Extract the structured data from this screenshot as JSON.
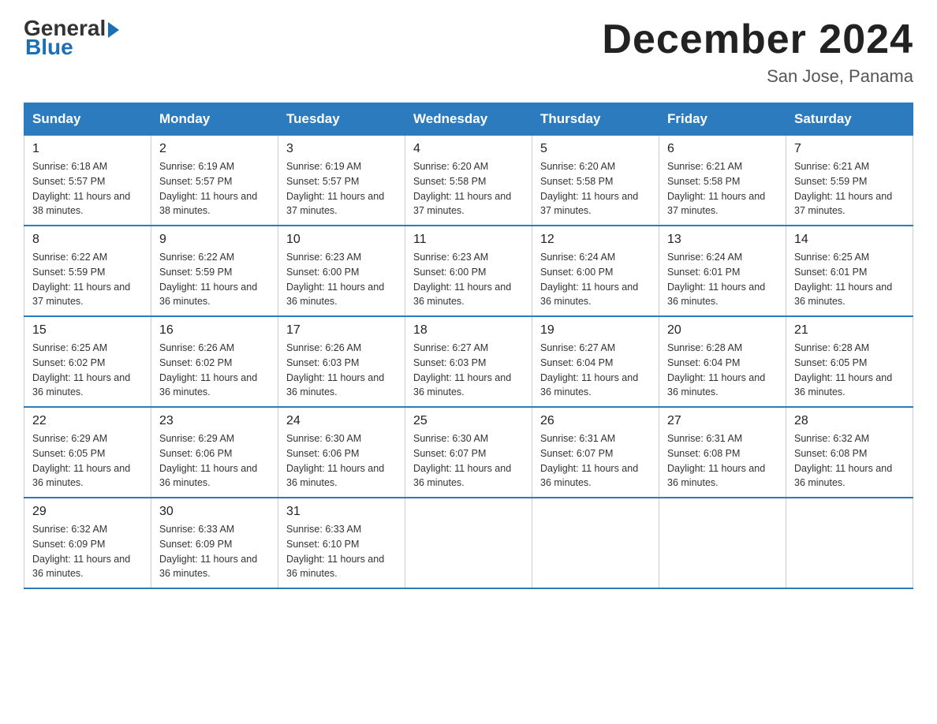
{
  "logo": {
    "general": "General",
    "arrow": "▶",
    "blue": "Blue"
  },
  "title": "December 2024",
  "subtitle": "San Jose, Panama",
  "headers": [
    "Sunday",
    "Monday",
    "Tuesday",
    "Wednesday",
    "Thursday",
    "Friday",
    "Saturday"
  ],
  "weeks": [
    [
      {
        "day": "1",
        "sunrise": "6:18 AM",
        "sunset": "5:57 PM",
        "daylight": "11 hours and 38 minutes."
      },
      {
        "day": "2",
        "sunrise": "6:19 AM",
        "sunset": "5:57 PM",
        "daylight": "11 hours and 38 minutes."
      },
      {
        "day": "3",
        "sunrise": "6:19 AM",
        "sunset": "5:57 PM",
        "daylight": "11 hours and 37 minutes."
      },
      {
        "day": "4",
        "sunrise": "6:20 AM",
        "sunset": "5:58 PM",
        "daylight": "11 hours and 37 minutes."
      },
      {
        "day": "5",
        "sunrise": "6:20 AM",
        "sunset": "5:58 PM",
        "daylight": "11 hours and 37 minutes."
      },
      {
        "day": "6",
        "sunrise": "6:21 AM",
        "sunset": "5:58 PM",
        "daylight": "11 hours and 37 minutes."
      },
      {
        "day": "7",
        "sunrise": "6:21 AM",
        "sunset": "5:59 PM",
        "daylight": "11 hours and 37 minutes."
      }
    ],
    [
      {
        "day": "8",
        "sunrise": "6:22 AM",
        "sunset": "5:59 PM",
        "daylight": "11 hours and 37 minutes."
      },
      {
        "day": "9",
        "sunrise": "6:22 AM",
        "sunset": "5:59 PM",
        "daylight": "11 hours and 36 minutes."
      },
      {
        "day": "10",
        "sunrise": "6:23 AM",
        "sunset": "6:00 PM",
        "daylight": "11 hours and 36 minutes."
      },
      {
        "day": "11",
        "sunrise": "6:23 AM",
        "sunset": "6:00 PM",
        "daylight": "11 hours and 36 minutes."
      },
      {
        "day": "12",
        "sunrise": "6:24 AM",
        "sunset": "6:00 PM",
        "daylight": "11 hours and 36 minutes."
      },
      {
        "day": "13",
        "sunrise": "6:24 AM",
        "sunset": "6:01 PM",
        "daylight": "11 hours and 36 minutes."
      },
      {
        "day": "14",
        "sunrise": "6:25 AM",
        "sunset": "6:01 PM",
        "daylight": "11 hours and 36 minutes."
      }
    ],
    [
      {
        "day": "15",
        "sunrise": "6:25 AM",
        "sunset": "6:02 PM",
        "daylight": "11 hours and 36 minutes."
      },
      {
        "day": "16",
        "sunrise": "6:26 AM",
        "sunset": "6:02 PM",
        "daylight": "11 hours and 36 minutes."
      },
      {
        "day": "17",
        "sunrise": "6:26 AM",
        "sunset": "6:03 PM",
        "daylight": "11 hours and 36 minutes."
      },
      {
        "day": "18",
        "sunrise": "6:27 AM",
        "sunset": "6:03 PM",
        "daylight": "11 hours and 36 minutes."
      },
      {
        "day": "19",
        "sunrise": "6:27 AM",
        "sunset": "6:04 PM",
        "daylight": "11 hours and 36 minutes."
      },
      {
        "day": "20",
        "sunrise": "6:28 AM",
        "sunset": "6:04 PM",
        "daylight": "11 hours and 36 minutes."
      },
      {
        "day": "21",
        "sunrise": "6:28 AM",
        "sunset": "6:05 PM",
        "daylight": "11 hours and 36 minutes."
      }
    ],
    [
      {
        "day": "22",
        "sunrise": "6:29 AM",
        "sunset": "6:05 PM",
        "daylight": "11 hours and 36 minutes."
      },
      {
        "day": "23",
        "sunrise": "6:29 AM",
        "sunset": "6:06 PM",
        "daylight": "11 hours and 36 minutes."
      },
      {
        "day": "24",
        "sunrise": "6:30 AM",
        "sunset": "6:06 PM",
        "daylight": "11 hours and 36 minutes."
      },
      {
        "day": "25",
        "sunrise": "6:30 AM",
        "sunset": "6:07 PM",
        "daylight": "11 hours and 36 minutes."
      },
      {
        "day": "26",
        "sunrise": "6:31 AM",
        "sunset": "6:07 PM",
        "daylight": "11 hours and 36 minutes."
      },
      {
        "day": "27",
        "sunrise": "6:31 AM",
        "sunset": "6:08 PM",
        "daylight": "11 hours and 36 minutes."
      },
      {
        "day": "28",
        "sunrise": "6:32 AM",
        "sunset": "6:08 PM",
        "daylight": "11 hours and 36 minutes."
      }
    ],
    [
      {
        "day": "29",
        "sunrise": "6:32 AM",
        "sunset": "6:09 PM",
        "daylight": "11 hours and 36 minutes."
      },
      {
        "day": "30",
        "sunrise": "6:33 AM",
        "sunset": "6:09 PM",
        "daylight": "11 hours and 36 minutes."
      },
      {
        "day": "31",
        "sunrise": "6:33 AM",
        "sunset": "6:10 PM",
        "daylight": "11 hours and 36 minutes."
      },
      null,
      null,
      null,
      null
    ]
  ],
  "cell_labels": {
    "sunrise": "Sunrise:",
    "sunset": "Sunset:",
    "daylight": "Daylight:"
  }
}
